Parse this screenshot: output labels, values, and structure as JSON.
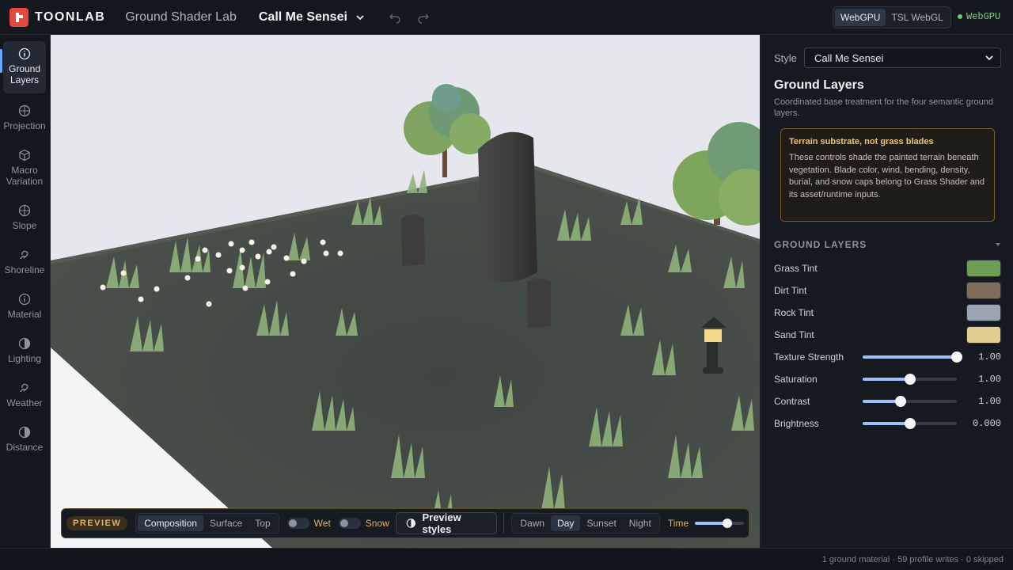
{
  "header": {
    "logo_text": "TOONLAB",
    "app_title": "Ground Shader Lab",
    "style_switch_label": "Call Me Sensei",
    "backends": [
      {
        "label": "WebGPU",
        "active": true
      },
      {
        "label": "TSL WebGL",
        "active": false
      }
    ],
    "status_text": "WebGPU",
    "status_color": "#5fcf6e"
  },
  "rail": {
    "items": [
      {
        "label": "Ground Layers",
        "icon": "info-circle-icon",
        "active": true
      },
      {
        "label": "Projection",
        "icon": "crosshair-circle-icon",
        "active": false
      },
      {
        "label": "Macro Variation",
        "icon": "grid-cube-icon",
        "active": false
      },
      {
        "label": "Slope",
        "icon": "crosshair-circle-icon",
        "active": false
      },
      {
        "label": "Shoreline",
        "icon": "wave-icon",
        "active": false
      },
      {
        "label": "Material",
        "icon": "info-circle-icon",
        "active": false
      },
      {
        "label": "Lighting",
        "icon": "half-moon-icon",
        "active": false
      },
      {
        "label": "Weather",
        "icon": "wind-icon",
        "active": false
      },
      {
        "label": "Distance",
        "icon": "half-moon-icon",
        "active": false
      }
    ]
  },
  "preview": {
    "badge": "PREVIEW",
    "views": [
      {
        "label": "Composition",
        "active": true
      },
      {
        "label": "Surface",
        "active": false
      },
      {
        "label": "Top",
        "active": false
      }
    ],
    "toggles": [
      {
        "label": "Wet",
        "on": false
      },
      {
        "label": "Snow",
        "on": false
      }
    ],
    "styles_button": "Preview styles",
    "times": [
      {
        "label": "Dawn",
        "active": false
      },
      {
        "label": "Day",
        "active": true
      },
      {
        "label": "Sunset",
        "active": false
      },
      {
        "label": "Night",
        "active": false
      }
    ],
    "time_label": "Time",
    "time_value": 0.66
  },
  "panel": {
    "style_label": "Style",
    "style_value": "Call Me Sensei",
    "title": "Ground Layers",
    "description": "Coordinated base treatment for the four semantic ground layers.",
    "callout": {
      "title": "Terrain substrate, not grass blades",
      "body": "These controls shade the painted terrain beneath vegetation. Blade color, wind, bending, density, burial, and snow caps belong to Grass Shader and its asset/runtime inputs."
    },
    "section_title": "GROUND LAYERS",
    "tints": [
      {
        "label": "Grass Tint",
        "color": "#6e9e55"
      },
      {
        "label": "Dirt Tint",
        "color": "#7d6e5b"
      },
      {
        "label": "Rock Tint",
        "color": "#9ba4b1"
      },
      {
        "label": "Sand Tint",
        "color": "#e3cd90"
      }
    ],
    "sliders": [
      {
        "label": "Texture Strength",
        "value": "1.00",
        "fraction": 1.0
      },
      {
        "label": "Saturation",
        "value": "1.00",
        "fraction": 0.5
      },
      {
        "label": "Contrast",
        "value": "1.00",
        "fraction": 0.4
      },
      {
        "label": "Brightness",
        "value": "0.000",
        "fraction": 0.5
      }
    ]
  },
  "footer": {
    "text": "1 ground material · 59 profile writes · 0 skipped"
  }
}
